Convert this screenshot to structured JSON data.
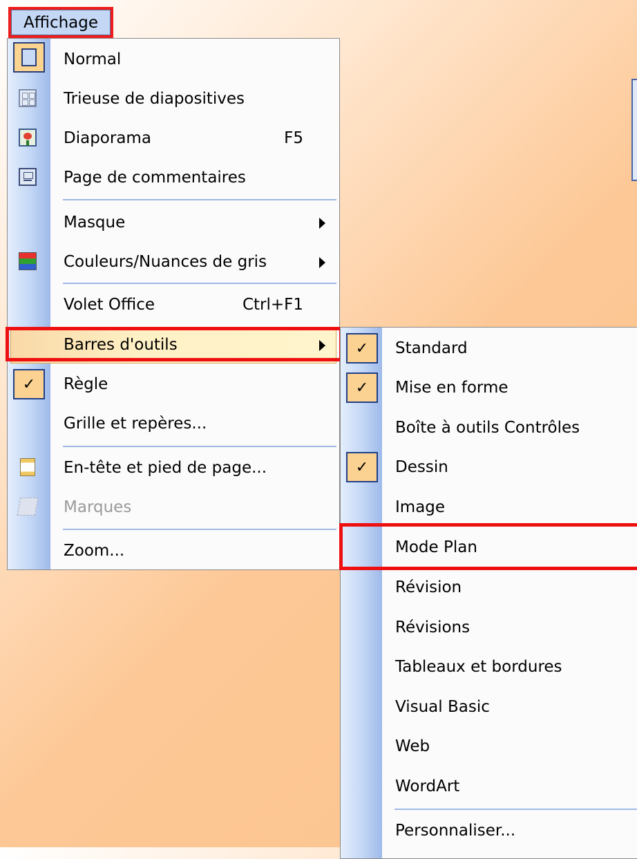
{
  "menubar": {
    "title": "Affichage"
  },
  "view_menu": {
    "items": [
      {
        "label": "Normal",
        "icon": "normal-view-icon"
      },
      {
        "label": "Trieuse de diapositives",
        "icon": "slide-sorter-icon"
      },
      {
        "label": "Diaporama",
        "shortcut": "F5",
        "icon": "slideshow-icon"
      },
      {
        "label": "Page de commentaires",
        "icon": "notes-page-icon"
      },
      {
        "label": "Masque"
      },
      {
        "label": "Couleurs/Nuances de gris",
        "icon": "color-grayscale-icon"
      },
      {
        "label": "Volet Office",
        "shortcut": "Ctrl+F1"
      },
      {
        "label": "Barres d'outils"
      },
      {
        "label": "Règle",
        "checked": true
      },
      {
        "label": "Grille et repères..."
      },
      {
        "label": "En-tête et pied de page...",
        "icon": "header-footer-icon"
      },
      {
        "label": "Marques",
        "disabled": true,
        "icon": "markup-icon"
      },
      {
        "label": "Zoom..."
      }
    ]
  },
  "toolbars_submenu": {
    "items": [
      {
        "label": "Standard",
        "checked": true
      },
      {
        "label": "Mise en forme",
        "checked": true
      },
      {
        "label": "Boîte à outils Contrôles"
      },
      {
        "label": "Dessin",
        "checked": true
      },
      {
        "label": "Image"
      },
      {
        "label": "Mode Plan"
      },
      {
        "label": "Révision"
      },
      {
        "label": "Révisions"
      },
      {
        "label": "Tableaux et bordures"
      },
      {
        "label": "Visual Basic"
      },
      {
        "label": "Web"
      },
      {
        "label": "WordArt"
      },
      {
        "label": "Personnaliser..."
      }
    ]
  },
  "glyphs": {
    "check": "✓"
  },
  "colors": {
    "highlight_border": "#ee1010",
    "menu_gutter": "#c2d6f5",
    "hover": "#fff1c6"
  }
}
